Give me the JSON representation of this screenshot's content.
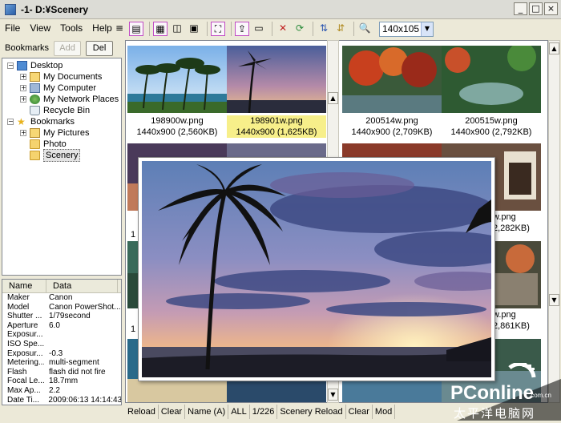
{
  "window": {
    "title": "-1-  D:¥Scenery",
    "minimize": "_",
    "maximize": "□",
    "close": "×"
  },
  "menu": [
    "File",
    "View",
    "Tools",
    "Help"
  ],
  "toolbar": {
    "thumb_size": "140x105"
  },
  "bookmarks": {
    "label": "Bookmarks",
    "add": "Add",
    "del": "Del"
  },
  "tree": [
    {
      "label": "Desktop",
      "icon": "desktop-icon",
      "expander": "−"
    },
    {
      "label": "My Documents",
      "icon": "folder-documents-icon",
      "expander": "+"
    },
    {
      "label": "My Computer",
      "icon": "computer-icon",
      "expander": "+"
    },
    {
      "label": "My Network Places",
      "icon": "network-icon",
      "expander": "+"
    },
    {
      "label": "Recycle Bin",
      "icon": "recycle-bin-icon",
      "expander": ""
    },
    {
      "label": "Bookmarks",
      "icon": "star-icon",
      "expander": "−"
    },
    {
      "label": "My Pictures",
      "icon": "folder-pictures-icon",
      "expander": "+"
    },
    {
      "label": "Photo",
      "icon": "folder-icon",
      "expander": ""
    },
    {
      "label": "Scenery",
      "icon": "folder-open-icon",
      "expander": ""
    }
  ],
  "props": {
    "headers": [
      "Name",
      "Data"
    ],
    "rows": [
      [
        "Maker",
        "Canon"
      ],
      [
        "Model",
        "Canon PowerShot..."
      ],
      [
        "Shutter ...",
        "1/79second"
      ],
      [
        "Aperture",
        "6.0"
      ],
      [
        "Exposur...",
        ""
      ],
      [
        "ISO Spe...",
        ""
      ],
      [
        "Exposur...",
        "-0.3"
      ],
      [
        "Metering...",
        "multi-segment"
      ],
      [
        "Flash",
        "flash did not fire"
      ],
      [
        "Focal Le...",
        "18.7mm"
      ],
      [
        "Max Ap...",
        "2.2"
      ],
      [
        "Date Ti...",
        "2009:06:13 14:14:43"
      ]
    ]
  },
  "thumbnails": [
    {
      "name": "198900w.png",
      "info": "1440x900 (2,560KB)"
    },
    {
      "name": "198901w.png",
      "info": "1440x900 (1,625KB)"
    },
    {
      "name": "200514w.png",
      "info": "1440x900 (2,709KB)"
    },
    {
      "name": "200515w.png",
      "info": "1440x900 (2,792KB)"
    }
  ],
  "partial_captions": [
    "1",
    "1",
    "w.png",
    "2,282KB)",
    "w.png",
    "2,861KB)"
  ],
  "status": [
    "Reload",
    "Clear",
    "Name (A)",
    "ALL",
    "1/226",
    "Scenery Reload",
    "Clear",
    "Mod"
  ],
  "watermark": {
    "logo": "PConline",
    "domain": ".com.cn",
    "cn": "太平洋电脑网"
  },
  "colors": {
    "selection_caption": "#f7ef8a",
    "window_bg": "#ece9d8",
    "toolbar_frame": "#c04bc4"
  }
}
